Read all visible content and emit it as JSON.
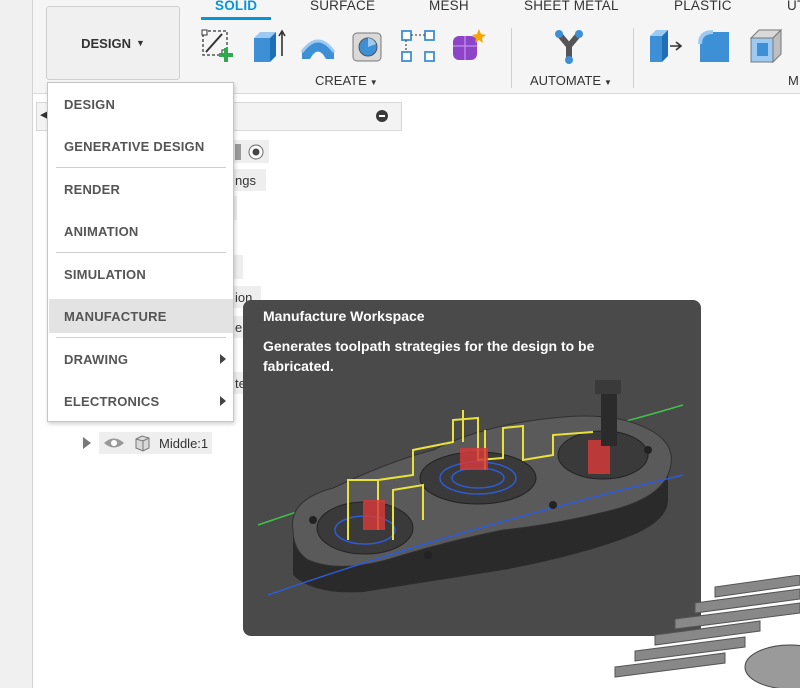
{
  "toolbar": {
    "workspace_button": "DESIGN",
    "tabs": [
      "SOLID",
      "SURFACE",
      "MESH",
      "SHEET METAL",
      "PLASTIC",
      "UT"
    ],
    "groups": {
      "create": "CREATE",
      "automate": "AUTOMATE",
      "modify": "M"
    },
    "tools": [
      "create-sketch-icon",
      "extrude-icon",
      "revolve-icon",
      "hole-icon",
      "pattern-icon",
      "form-icon",
      "automate-icon",
      "press-pull-icon",
      "fillet-icon",
      "shell-icon"
    ]
  },
  "browser": {
    "fragments": [
      "ngs",
      "ion",
      "er",
      "te"
    ],
    "tree_item": "Middle:1"
  },
  "dropdown": {
    "items": [
      {
        "label": "DESIGN"
      },
      {
        "label": "GENERATIVE DESIGN"
      },
      {
        "label": "RENDER"
      },
      {
        "label": "ANIMATION"
      },
      {
        "label": "SIMULATION"
      },
      {
        "label": "MANUFACTURE"
      },
      {
        "label": "DRAWING"
      },
      {
        "label": "ELECTRONICS"
      }
    ]
  },
  "tooltip": {
    "title": "Manufacture Workspace",
    "description": "Generates toolpath strategies for the design to be fabricated."
  },
  "colors": {
    "accent": "#0696d7",
    "tooltip_bg": "#4a4a4a",
    "hover": "#e3e3e3"
  }
}
